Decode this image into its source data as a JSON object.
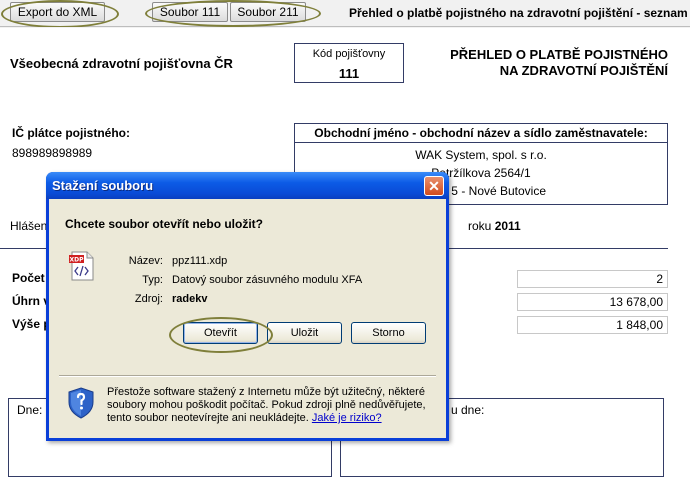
{
  "toolbar": {
    "export_label": "Export do XML",
    "soubor111_label": "Soubor 111",
    "soubor211_label": "Soubor 211",
    "title": "Přehled o platbě pojistného na zdravotní pojištění - seznam"
  },
  "form": {
    "insurer_name": "Všeobecná zdravotní pojišťovna ČR",
    "code_label": "Kód pojišťovny",
    "code_value": "111",
    "heading_line1": "PŘEHLED O PLATBĚ POJISTNÉHO",
    "heading_line2": "NA ZDRAVOTNÍ POJIŠTĚNÍ",
    "ic_label": "IČ plátce pojistného:",
    "ic_value": "898989898989",
    "employer_heading": "Obchodní jméno - obchodní název a sídlo zaměstnavatele:",
    "employer_name": "WAK System, spol. s r.o.",
    "employer_street": "Petržílkova 2564/1",
    "employer_city": "Praha 5 - Nové Butovice",
    "report_label_partial": "Hlášen",
    "year_label": "roku",
    "year_value": "2011",
    "row1_label": "Počet",
    "row2_label": "Úhrn v",
    "row3_label": "Výše p",
    "row1_value": "2",
    "row2_value": "13 678,00",
    "row3_value": "1 848,00",
    "date_left_label": "Dne:",
    "date_right_label": "u dne:"
  },
  "dialog": {
    "title": "Stažení souboru",
    "close_glyph": "✕",
    "question": "Chcete soubor otevřít nebo uložit?",
    "file_icon_tag": "XDP",
    "name_label": "Název:",
    "name_value": "ppz111.xdp",
    "type_label": "Typ:",
    "type_value": "Datový soubor zásuvného modulu XFA",
    "source_label": "Zdroj:",
    "source_value": "radekv",
    "open_label": "Otevřít",
    "save_label": "Uložit",
    "cancel_label": "Storno",
    "warning_text": "Přestože software stažený z Internetu může být užitečný, některé soubory mohou poškodit počítač. Pokud zdroji plně nedůvěřujete, tento soubor neotevírejte ani neukládejte.",
    "risk_link": "Jaké je riziko?"
  }
}
